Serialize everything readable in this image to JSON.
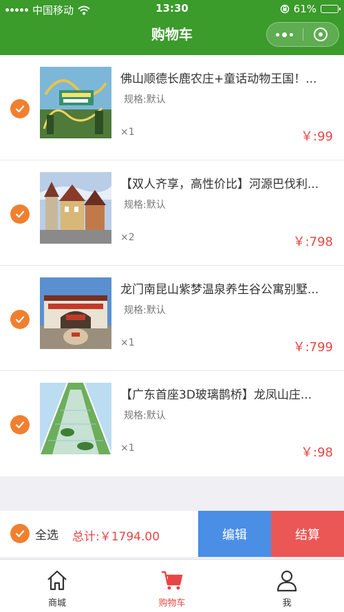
{
  "status_bar": {
    "carrier": "中国移动",
    "time": "13:30",
    "battery": "61%",
    "battery_level": 0.61
  },
  "nav": {
    "title": "购物车"
  },
  "cart": {
    "items": [
      {
        "title": "佛山顺德长鹿农庄+童话动物王国！...",
        "spec": "规格:默认",
        "qty": "×1",
        "price": "￥:99",
        "image": "amusement-park-rollercoaster"
      },
      {
        "title": "【双人齐享，高性价比】河源巴伐利...",
        "spec": "规格:默认",
        "qty": "×2",
        "price": "￥:798",
        "image": "bavarian-town"
      },
      {
        "title": "龙门南昆山紫梦温泉养生谷公寓别墅...",
        "spec": "规格:默认",
        "qty": "×1",
        "price": "￥:799",
        "image": "hot-spring-gate"
      },
      {
        "title": "【广东首座3D玻璃鹊桥】龙凤山庄...",
        "spec": "规格:默认",
        "qty": "×1",
        "price": "￥:98",
        "image": "glass-bridge"
      }
    ]
  },
  "footer": {
    "select_all": "全选",
    "total": "总计:￥1794.00",
    "edit": "编辑",
    "checkout": "结算"
  },
  "tabbar": {
    "tabs": [
      {
        "label": "商城",
        "icon": "home-icon"
      },
      {
        "label": "购物车",
        "icon": "cart-icon"
      },
      {
        "label": "我",
        "icon": "user-icon"
      }
    ]
  },
  "colors": {
    "header": "#3b9b2b",
    "check": "#f08030",
    "price": "#e84545",
    "edit": "#4a8ee6",
    "checkout": "#ea5754"
  }
}
